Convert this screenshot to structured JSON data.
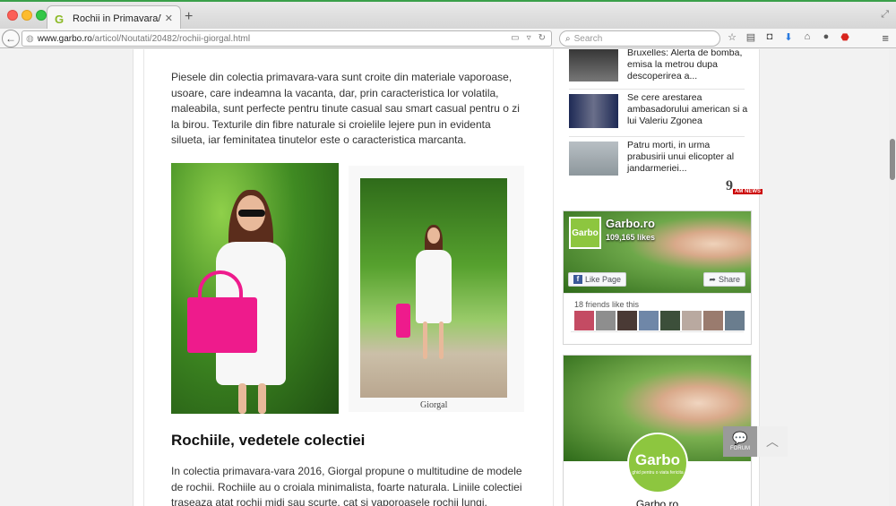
{
  "browser": {
    "tab_title": "Rochii in Primavara/Vara ...",
    "tab_favicon": "G",
    "url_domain": "www.garbo.ro",
    "url_path": "/articol/Noutati/20482/rochii-giorgal.html",
    "search_placeholder": "Search",
    "new_tab": "+",
    "close_tab": "✕"
  },
  "article": {
    "paragraph1": "Piesele din colectia primavara-vara sunt croite din materiale vaporoase, usoare, care indeamna la vacanta, dar, prin caracteristica lor volatila, maleabila, sunt perfecte pentru tinute casual sau smart casual pentru o zi la birou. Texturile din fibre naturale si croielile lejere pun in evidenta silueta, iar feminitatea tinutelor este o caracteristica marcanta.",
    "photo_caption": "Giorgal",
    "heading": "Rochiile, vedetele colectiei",
    "paragraph2": "In colectia primavara-vara 2016, Giorgal propune o multitudine de modele de rochii. Rochiile au o croiala minimalista, foarte naturala. Liniile colectiei traseaza atat rochii midi sau scurte, cat si vaporoasele rochii lungi."
  },
  "sidebar": {
    "news": [
      {
        "text": "Bruxelles: Alerta de bomba, emisa la metrou dupa descoperirea a..."
      },
      {
        "text": "Se cere arestarea ambasadorului american si a lui Valeriu Zgonea"
      },
      {
        "text": "Patru morti, in urma prabusirii unui elicopter al jandarmeriei..."
      }
    ],
    "news_logo": "9",
    "news_logo_sub": "AM NEWS",
    "facebook": {
      "logo_text": "Garbo",
      "page_name": "Garbo.ro",
      "likes": "109,165 likes",
      "like_button": "Like Page",
      "share_button": "Share",
      "friends_text": "18 friends like this"
    },
    "ad": {
      "logo_text": "Garbo",
      "tagline": "ghid pentru o viata fericita",
      "name": "Garbo.ro"
    }
  },
  "floaters": {
    "forum_label": "FORUM"
  },
  "colors": {
    "brand_green": "#8dc63f",
    "bag_pink": "#ee1b8c",
    "facebook_blue": "#3b5998"
  }
}
